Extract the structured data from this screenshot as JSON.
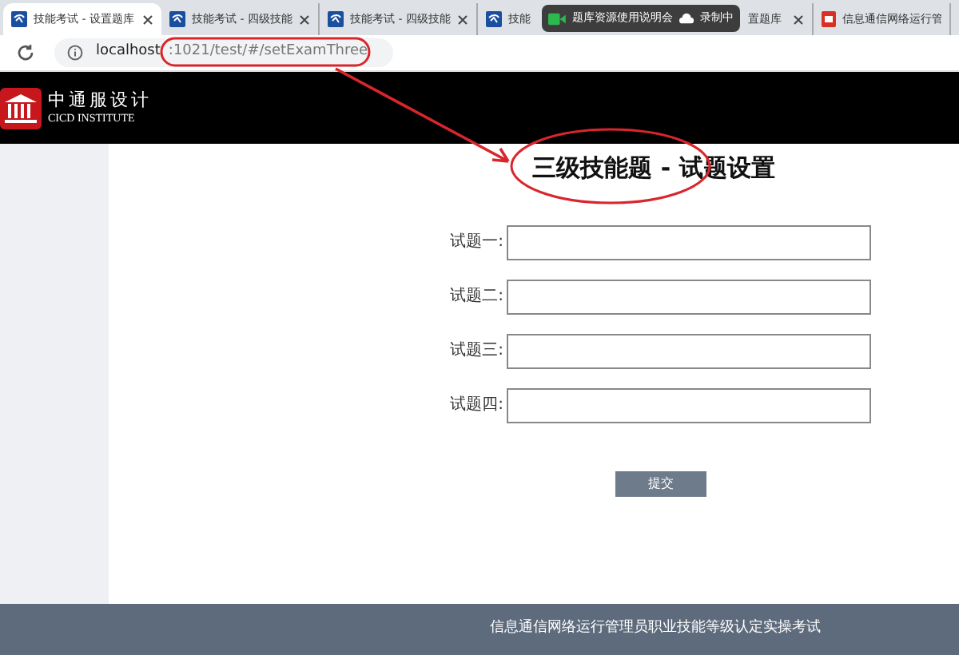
{
  "browser": {
    "tabs": [
      {
        "kind": "page",
        "label": "技能考试 - 设置题库",
        "selected": true
      },
      {
        "kind": "page",
        "label": "技能考试 - 四级技能",
        "selected": false
      },
      {
        "kind": "page",
        "label": "技能考试 - 四级技能",
        "selected": false
      },
      {
        "kind": "page",
        "label": "技能",
        "selected": false
      },
      {
        "kind": "none",
        "label": "置题库",
        "selected": false
      },
      {
        "kind": "pdf",
        "label": "信息通信网络运行管",
        "selected": false
      }
    ],
    "overlay": {
      "meeting": "题库资源使用说明会",
      "recording": "录制中"
    },
    "address": {
      "host": "localhost",
      "rest": ":1021/test/#/setExamThree"
    }
  },
  "header": {
    "logo_cn": "中通服设计",
    "logo_en": "CICD INSTITUTE"
  },
  "form": {
    "title": "三级技能题 - 试题设置",
    "fields": [
      {
        "label": "试题一:"
      },
      {
        "label": "试题二:"
      },
      {
        "label": "试题三:"
      },
      {
        "label": "试题四:"
      }
    ],
    "submit": "提交"
  },
  "footer": "信息通信网络运行管理员职业技能等级认定实操考试"
}
